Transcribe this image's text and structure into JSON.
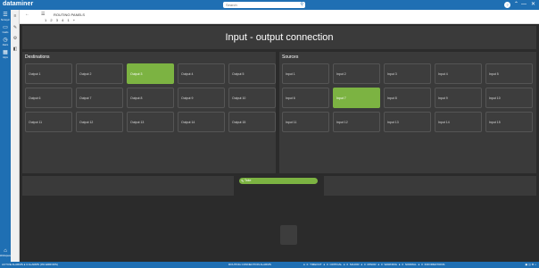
{
  "app": {
    "logo": "dataminer",
    "search_placeholder": "Search",
    "user_initial": "?"
  },
  "window_controls": [
    "⌃",
    "—",
    "✕"
  ],
  "sidebar": {
    "items": [
      {
        "label": "Surveyor",
        "icon": "tree-icon"
      },
      {
        "label": "Cards",
        "icon": "cards-icon"
      },
      {
        "label": "Alarm",
        "icon": "alarm-icon"
      },
      {
        "label": "Apps",
        "icon": "apps-icon"
      }
    ],
    "bottom_label": "Workspace"
  },
  "breadcrumb": {
    "back": "←",
    "title": "ROUTING PANELS",
    "pages": [
      "1",
      "2",
      "3",
      "4",
      "1",
      "+"
    ]
  },
  "heading": "Input - output connection",
  "destinations": {
    "title": "Destinations",
    "tiles": [
      "Output 1",
      "Output 2",
      "Output 3",
      "Output 4",
      "Output 5",
      "Output 6",
      "Output 7",
      "Output 8",
      "Output 9",
      "Output 10",
      "Output 11",
      "Output 12",
      "Output 13",
      "Output 14",
      "Output 15"
    ],
    "selected_index": 2
  },
  "sources": {
    "title": "Sources",
    "tiles": [
      "Input 1",
      "Input 2",
      "Input 3",
      "Input 4",
      "Input 5",
      "Input 6",
      "Input 7",
      "Input 8",
      "Input 9",
      "Input 10",
      "Input 11",
      "Input 12",
      "Input 13",
      "Input 14",
      "Input 15"
    ],
    "selected_index": 6
  },
  "take_button": "Take",
  "statusbar": {
    "left": "ACTIVE ALARMS  ● 0 ALARMS (0% ERRORS)",
    "center": "ROUTING CONNECTION ALARMS",
    "right": "● 0 TIMEOUT  ● 0 CRITICAL  ● 0 MAJOR  ● 0 MINOR  ● 0 WARNING  ● 0 NORMAL  ● 0 INFORMATIONS"
  },
  "colors": {
    "accent": "#1f6fb3",
    "selected": "#7cb342",
    "panel": "#3a3a3a"
  }
}
